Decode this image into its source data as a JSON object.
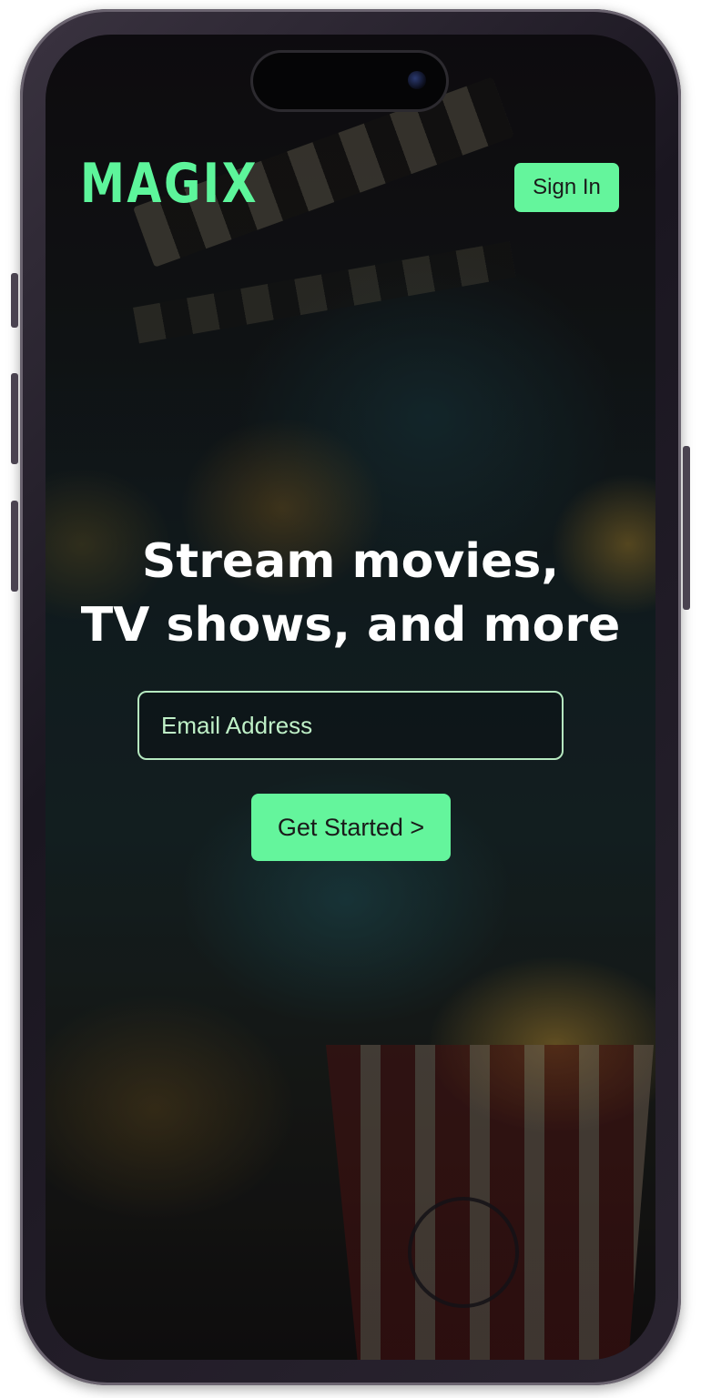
{
  "header": {
    "logo_text": "MAGIX",
    "signin_label": "Sign In"
  },
  "hero": {
    "title_line1": "Stream movies,",
    "title_line2": "TV shows, and more"
  },
  "signup": {
    "email_placeholder": "Email Address",
    "cta_label": "Get Started >"
  },
  "colors": {
    "accent": "#64f59c",
    "logo": "#5df59b",
    "input_border": "#b6e9c0"
  }
}
